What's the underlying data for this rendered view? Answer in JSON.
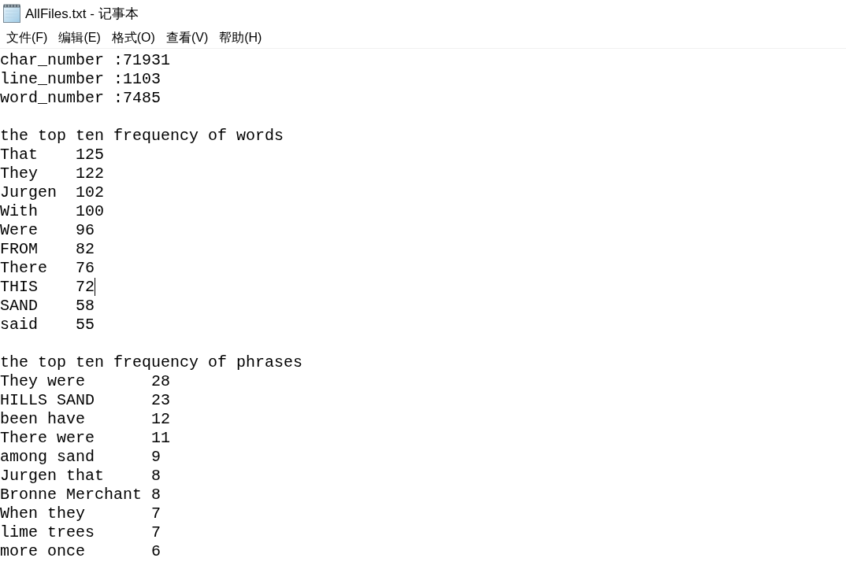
{
  "window": {
    "title": "AllFiles.txt - 记事本"
  },
  "menu": [
    {
      "label": "文件(F)"
    },
    {
      "label": "编辑(E)"
    },
    {
      "label": "格式(O)"
    },
    {
      "label": "查看(V)"
    },
    {
      "label": "帮助(H)"
    }
  ],
  "document": {
    "stats": [
      "char_number :71931",
      "line_number :1103",
      "word_number :7485"
    ],
    "words_heading": "the top ten frequency of words",
    "words": [
      {
        "word": "That",
        "count": "125",
        "caret": false
      },
      {
        "word": "They",
        "count": "122",
        "caret": false
      },
      {
        "word": "Jurgen",
        "count": "102",
        "caret": false
      },
      {
        "word": "With",
        "count": "100",
        "caret": false
      },
      {
        "word": "Were",
        "count": "96",
        "caret": false
      },
      {
        "word": "FROM",
        "count": "82",
        "caret": false
      },
      {
        "word": "There",
        "count": "76",
        "caret": false
      },
      {
        "word": "THIS",
        "count": "72",
        "caret": true
      },
      {
        "word": "SAND",
        "count": "58",
        "caret": false
      },
      {
        "word": "said",
        "count": "55",
        "caret": false
      }
    ],
    "phrases_heading": "the top ten frequency of phrases",
    "phrases": [
      {
        "phrase": "They were",
        "count": "28"
      },
      {
        "phrase": "HILLS SAND",
        "count": "23"
      },
      {
        "phrase": "been have",
        "count": "12"
      },
      {
        "phrase": "There were",
        "count": "11"
      },
      {
        "phrase": "among sand",
        "count": "9"
      },
      {
        "phrase": "Jurgen that",
        "count": "8"
      },
      {
        "phrase": "Bronne Merchant",
        "count": "8"
      },
      {
        "phrase": "When they",
        "count": "7"
      },
      {
        "phrase": "lime trees",
        "count": "7"
      },
      {
        "phrase": "more once",
        "count": "6"
      }
    ]
  }
}
